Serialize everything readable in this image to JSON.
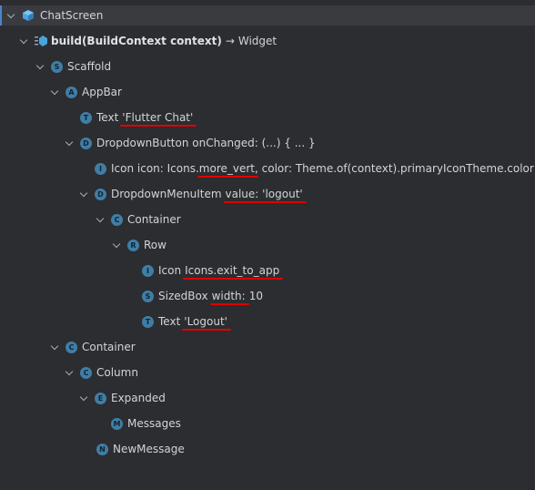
{
  "tree": {
    "root": {
      "label": "ChatScreen",
      "icon": "widget-cube-icon"
    },
    "build": {
      "name": "build(BuildContext context)",
      "arrow": "→",
      "return_type": "Widget"
    },
    "nodes": {
      "scaffold": {
        "badge": "S",
        "label": "Scaffold"
      },
      "appbar": {
        "badge": "A",
        "label": "AppBar"
      },
      "text_title": {
        "badge": "T",
        "prefix": "Text",
        "value": "'Flutter Chat'"
      },
      "dropdown": {
        "badge": "D",
        "label": "DropdownButton onChanged: (...) { ... }"
      },
      "icon_more": {
        "badge": "I",
        "prefix": "Icon icon: Icons.",
        "value": "more_vert",
        "suffix": ", color: Theme.of(context).primaryIconTheme.color"
      },
      "menu_item": {
        "badge": "D",
        "prefix": "DropdownMenuItem",
        "value": "value: 'logout'"
      },
      "container_1": {
        "badge": "C",
        "label": "Container"
      },
      "row": {
        "badge": "R",
        "label": "Row"
      },
      "icon_exit": {
        "badge": "I",
        "prefix": "Icon",
        "value": "Icons.exit_to_app"
      },
      "sizedbox": {
        "badge": "S",
        "prefix": "SizedBox",
        "value": "width:",
        "suffix": "10"
      },
      "text_logout": {
        "badge": "T",
        "prefix": "Text",
        "value": "'Logout'"
      },
      "container_2": {
        "badge": "C",
        "label": "Container"
      },
      "column": {
        "badge": "C",
        "label": "Column"
      },
      "expanded": {
        "badge": "E",
        "label": "Expanded"
      },
      "messages": {
        "badge": "M",
        "label": "Messages"
      },
      "new_message": {
        "badge": "N",
        "label": "NewMessage"
      }
    }
  },
  "colors": {
    "background": "#2b2d30",
    "selected_row": "#393b40",
    "badge": "#3f7ea6",
    "text": "#d2d4d8",
    "underline_annotation": "#e00000"
  }
}
